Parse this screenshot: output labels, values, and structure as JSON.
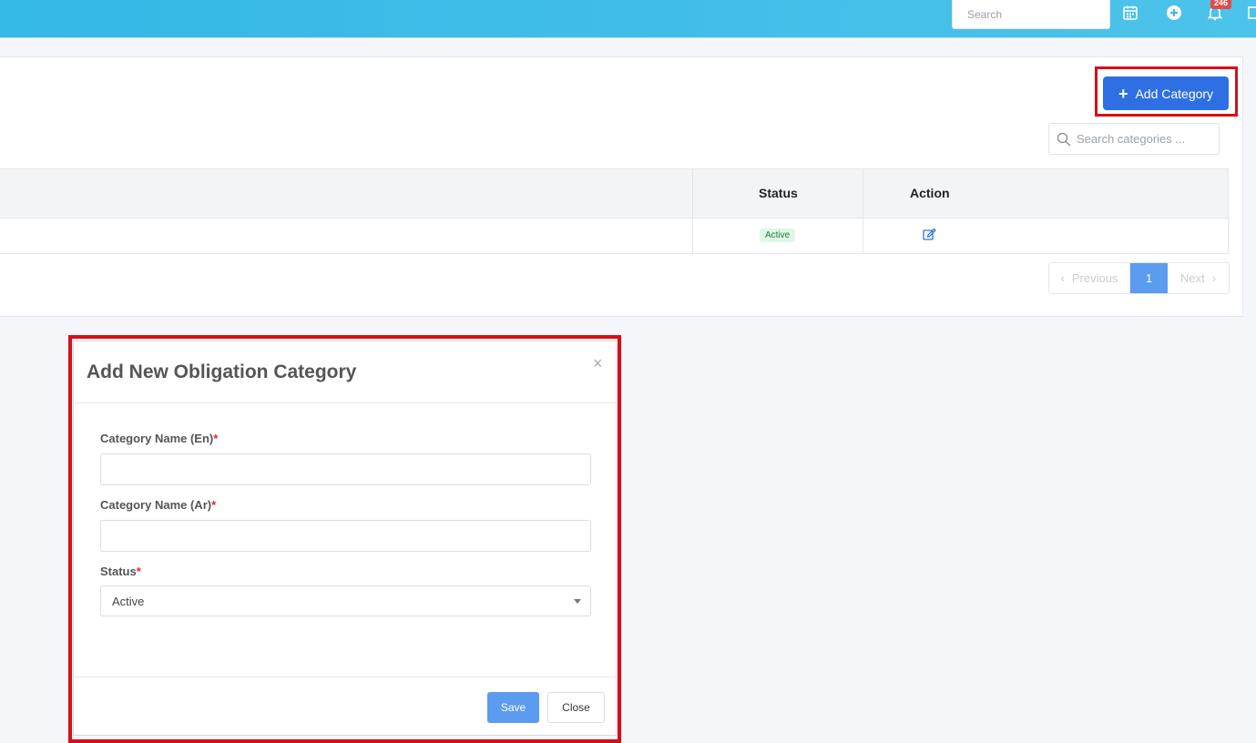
{
  "header": {
    "search_placeholder": "Search",
    "notification_count": "246"
  },
  "toolbar": {
    "add_category_label": "Add Category",
    "search_placeholder": "Search categories ..."
  },
  "table": {
    "columns": [
      "Status",
      "Action"
    ],
    "rows": [
      {
        "status": "Active"
      }
    ]
  },
  "pagination": {
    "previous_label": "Previous",
    "current_page": "1",
    "next_label": "Next"
  },
  "modal": {
    "title": "Add New Obligation Category",
    "close_symbol": "×",
    "fields": [
      {
        "label": "Category Name (En)",
        "required_mark": "*",
        "value": ""
      },
      {
        "label": "Category Name (Ar)",
        "required_mark": "*",
        "value": ""
      },
      {
        "label": "Status",
        "required_mark": "*",
        "value": "Active"
      }
    ],
    "save_label": "Save",
    "close_label": "Close"
  },
  "colors": {
    "topbar": "#34b8e6",
    "primary_button": "#2f6fe4",
    "highlight_border": "#d60f17",
    "active_badge_bg": "#e0f6e6"
  },
  "icons": [
    "calendar-icon",
    "plus-circle-icon",
    "bell-icon",
    "search-icon",
    "edit-icon",
    "chevron-left-icon",
    "chevron-right-icon"
  ]
}
